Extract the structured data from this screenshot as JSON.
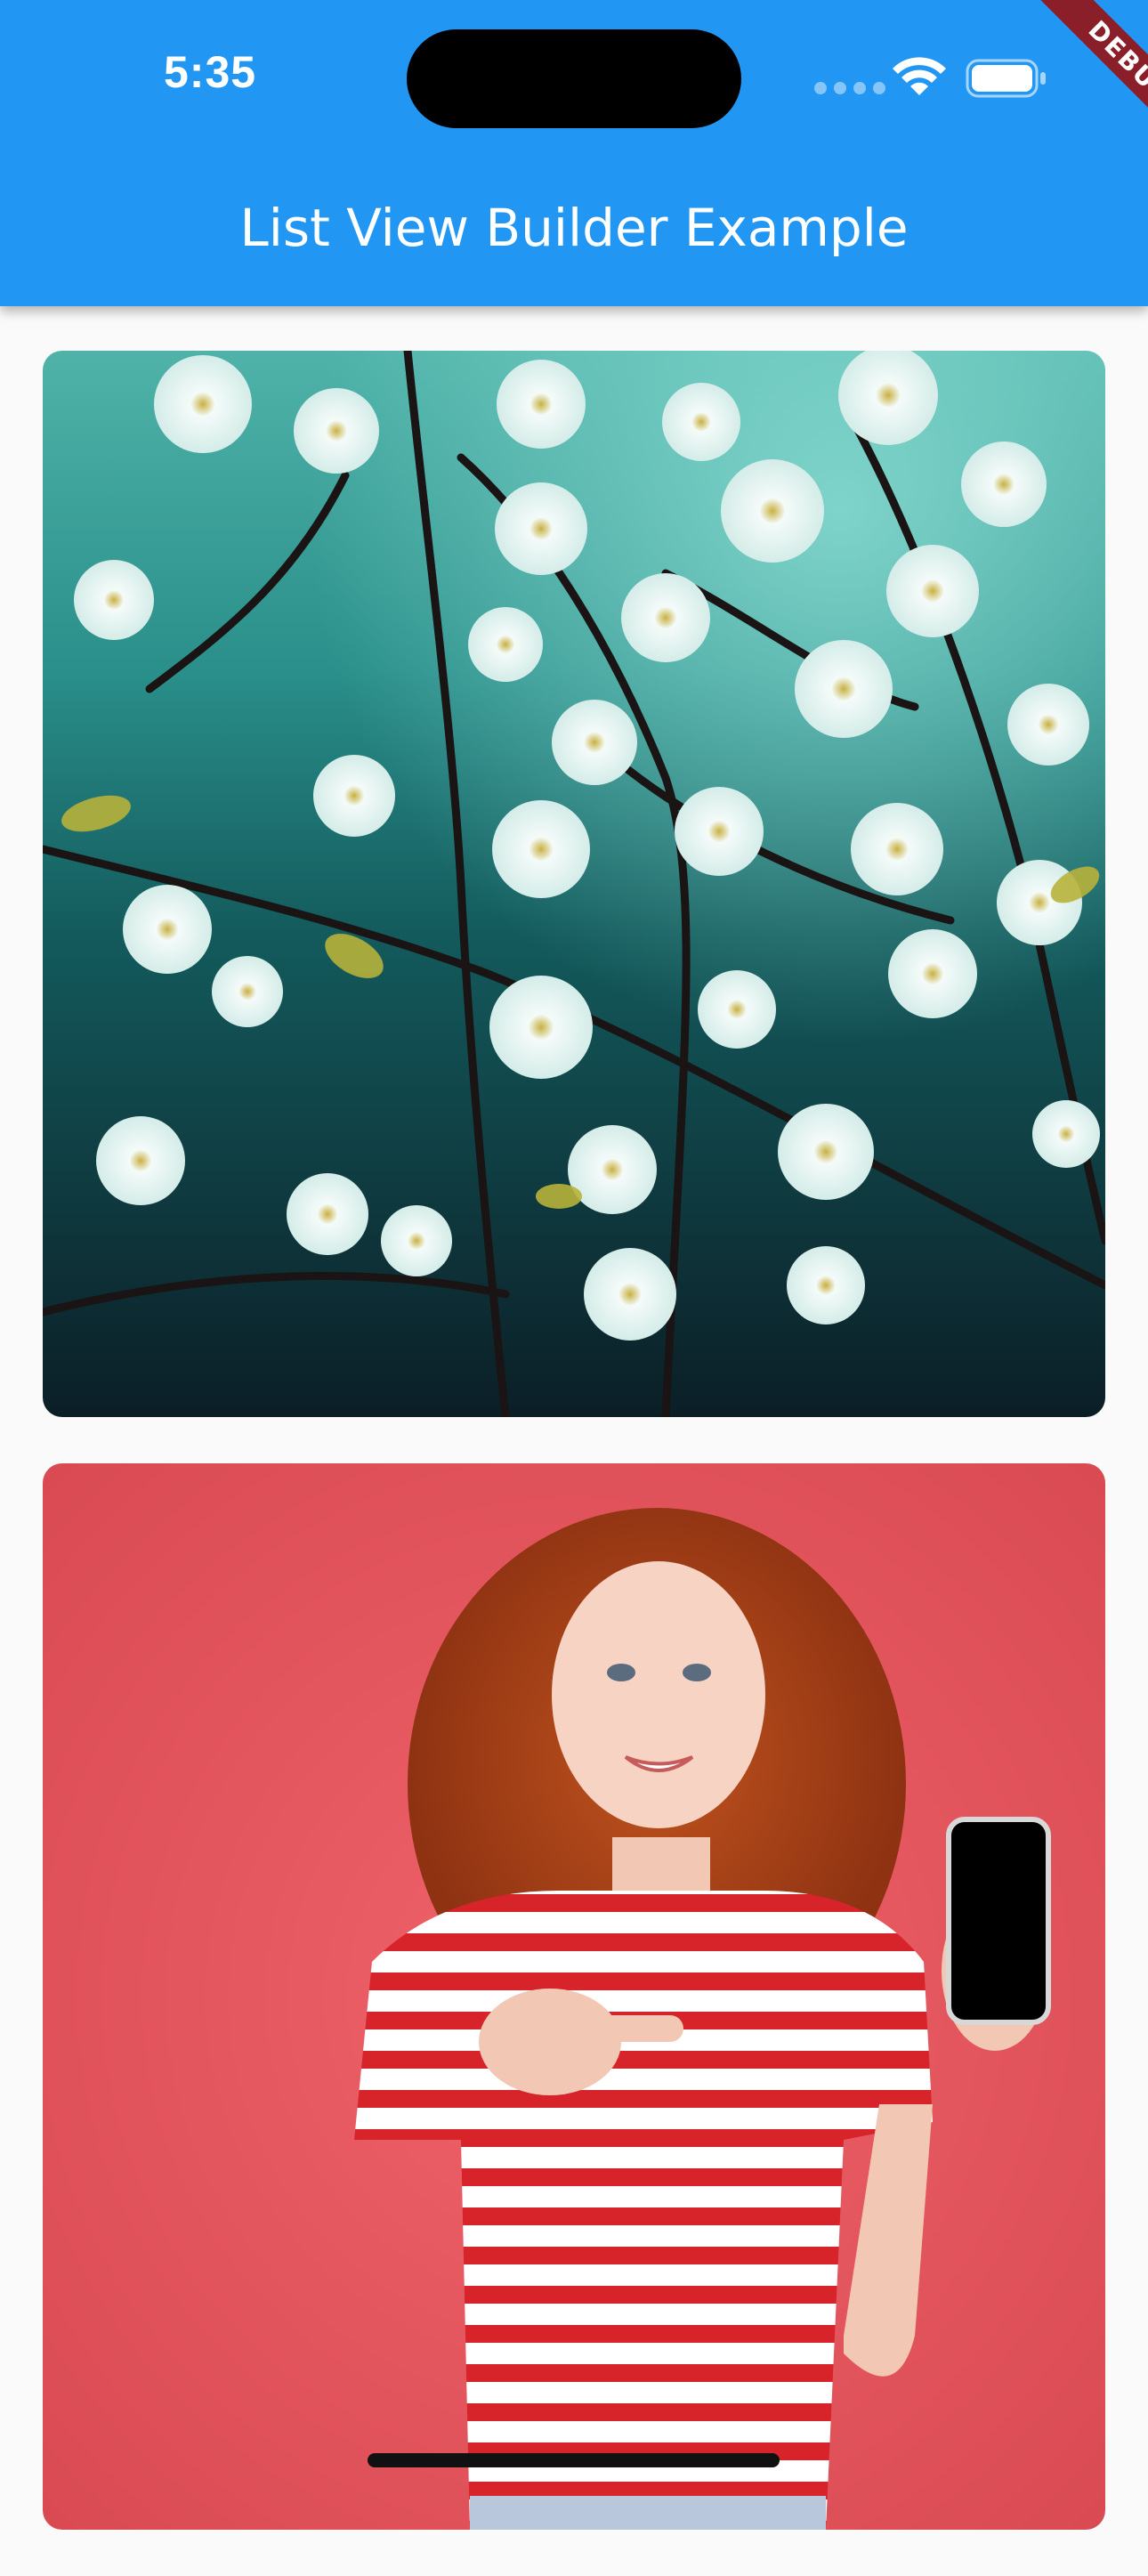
{
  "status_bar": {
    "time": "5:35"
  },
  "app_bar": {
    "title": "List View Builder Example",
    "color": "#2196f3"
  },
  "debug_banner": {
    "label": "DEBUG"
  },
  "list": {
    "items": [
      {
        "icon": "photo-cherry-blossoms"
      },
      {
        "icon": "photo-woman-with-phone"
      }
    ]
  }
}
